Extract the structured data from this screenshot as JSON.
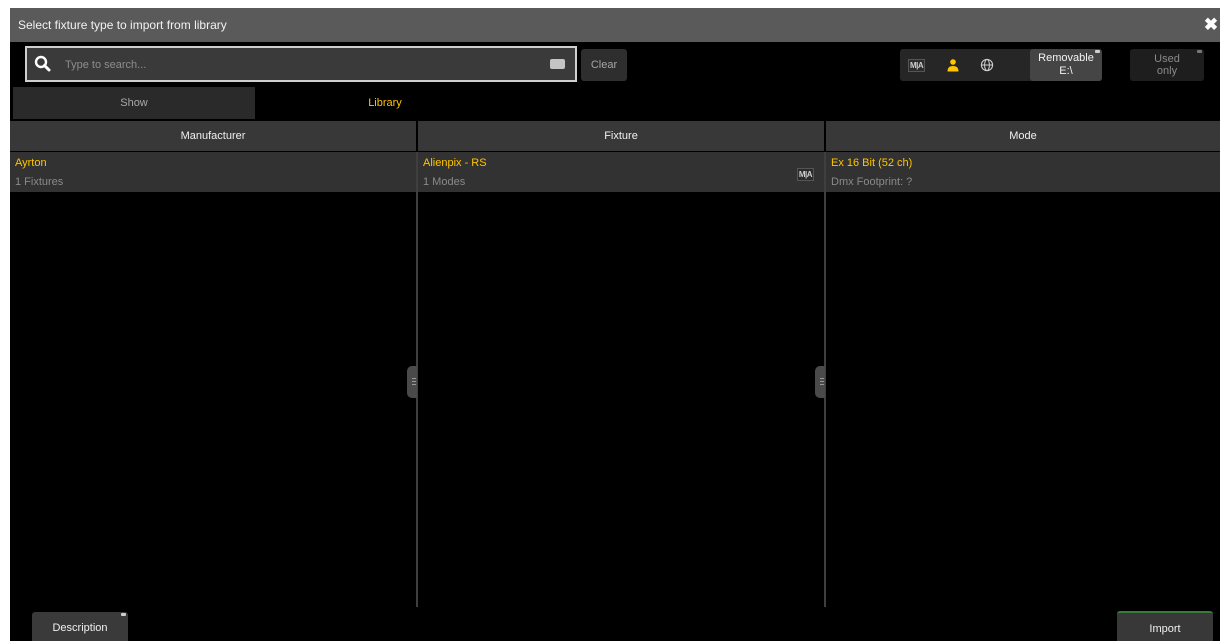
{
  "dialog": {
    "title": "Select fixture type to import from library",
    "close_glyph": "✖"
  },
  "search": {
    "placeholder": "Type to search...",
    "value": "",
    "clear_label": "Clear",
    "icon": "search-icon",
    "keyboard_icon": "keyboard-icon"
  },
  "filters": {
    "ma_label": "M|A",
    "user_icon": "user-icon",
    "globe_icon": "globe-icon",
    "removable_line1": "Removable",
    "removable_line2": "E:\\",
    "used_line1": "Used",
    "used_line2": "only"
  },
  "tabs": [
    {
      "label": "Show",
      "active": false
    },
    {
      "label": "Library",
      "active": true
    }
  ],
  "columns": {
    "manufacturer": {
      "header": "Manufacturer",
      "rows": [
        {
          "primary": "Ayrton",
          "secondary": "1 Fixtures"
        }
      ]
    },
    "fixture": {
      "header": "Fixture",
      "rows": [
        {
          "primary": "Alienpix - RS",
          "secondary": "1 Modes",
          "badge": "M|A"
        }
      ]
    },
    "mode": {
      "header": "Mode",
      "rows": [
        {
          "primary": "Ex 16 Bit (52 ch)",
          "secondary": "Dmx Footprint: ?"
        }
      ]
    }
  },
  "footer": {
    "description_label": "Description",
    "import_label": "Import"
  },
  "colors": {
    "accent": "#ffc500",
    "titlebar": "#5a5a5a",
    "background": "#000000",
    "import_border": "#3a7a3a"
  }
}
